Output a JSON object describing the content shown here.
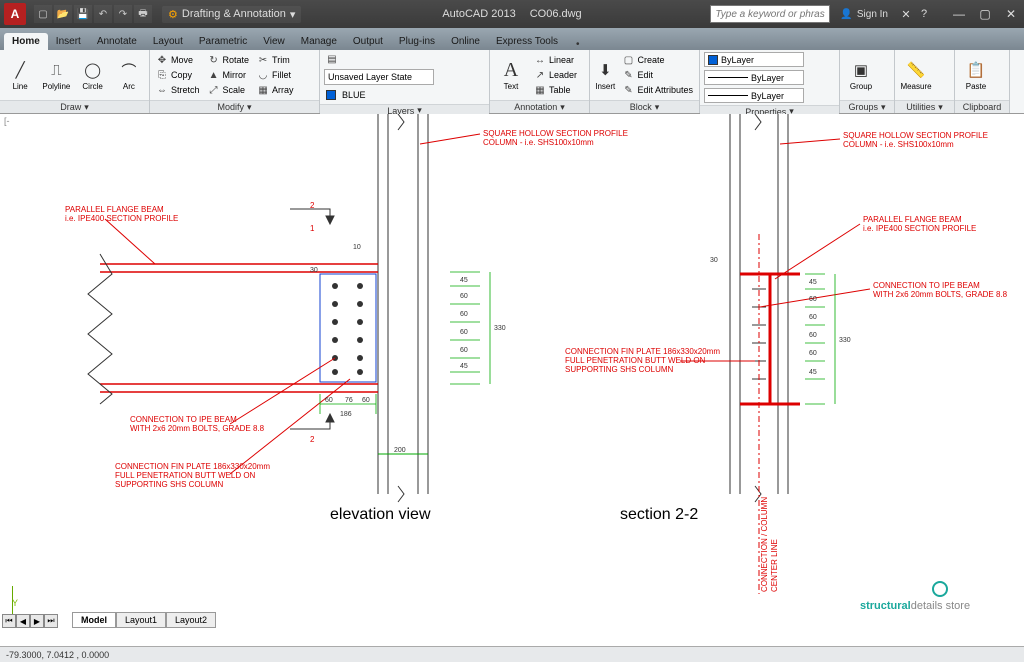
{
  "app": {
    "name": "AutoCAD 2013",
    "file": "CO06.dwg",
    "workspace": "Drafting & Annotation"
  },
  "qat": [
    "new",
    "open",
    "save",
    "undo",
    "redo",
    "plot"
  ],
  "search": {
    "placeholder": "Type a keyword or phrase"
  },
  "signin": {
    "label": "Sign In"
  },
  "tabs": [
    "Home",
    "Insert",
    "Annotate",
    "Layout",
    "Parametric",
    "View",
    "Manage",
    "Output",
    "Plug-ins",
    "Online",
    "Express Tools"
  ],
  "active_tab": "Home",
  "ribbon": {
    "draw": {
      "label": "Draw",
      "items": [
        "Line",
        "Polyline",
        "Circle",
        "Arc"
      ]
    },
    "modify": {
      "label": "Modify",
      "rows": [
        [
          "Move",
          "Rotate",
          "Trim"
        ],
        [
          "Copy",
          "Mirror",
          "Fillet"
        ],
        [
          "Stretch",
          "Scale",
          "Array"
        ]
      ]
    },
    "layers": {
      "label": "Layers",
      "state": "Unsaved Layer State",
      "current": "BLUE"
    },
    "annotation": {
      "label": "Annotation",
      "text": "Text",
      "items": [
        "Linear",
        "Leader",
        "Table"
      ]
    },
    "block": {
      "label": "Block",
      "insert": "Insert",
      "items": [
        "Create",
        "Edit",
        "Edit Attributes"
      ]
    },
    "properties": {
      "label": "Properties",
      "layer": "ByLayer"
    },
    "groups": {
      "label": "Groups",
      "item": "Group"
    },
    "utilities": {
      "label": "Utilities",
      "item": "Measure"
    },
    "clipboard": {
      "label": "Clipboard",
      "item": "Paste"
    }
  },
  "model_tabs": [
    "Model",
    "Layout1",
    "Layout2"
  ],
  "status": {
    "coords": "-79.3000, 7.0412 , 0.0000"
  },
  "drawing": {
    "view_left": "elevation view",
    "view_right": "section 2-2",
    "notes": {
      "shs": "SQUARE HOLLOW SECTION PROFILE",
      "shs2": "COLUMN - i.e. SHS100x10mm",
      "pfb": "PARALLEL FLANGE BEAM",
      "pfb2": "i.e. IPE400 SECTION PROFILE",
      "bolts": "CONNECTION TO IPE BEAM",
      "bolts2": "WITH 2x6 20mm BOLTS, GRADE 8.8",
      "fin": "CONNECTION FIN PLATE 186x330x20mm",
      "fin2": "FULL PENETRATION BUTT WELD ON",
      "fin3": "SUPPORTING SHS COLUMN",
      "centerline": "CONNECTION / COLUMN",
      "centerline2": "CENTER LINE"
    },
    "dims": {
      "d10": "10",
      "d30": "30",
      "d45": "45",
      "d60": "60",
      "d76": "76",
      "d186": "186",
      "d200": "200",
      "d330": "330"
    },
    "sections": {
      "s1": "1",
      "s2": "2"
    },
    "watermark": {
      "brand": "structural",
      "rest": "details store"
    }
  }
}
